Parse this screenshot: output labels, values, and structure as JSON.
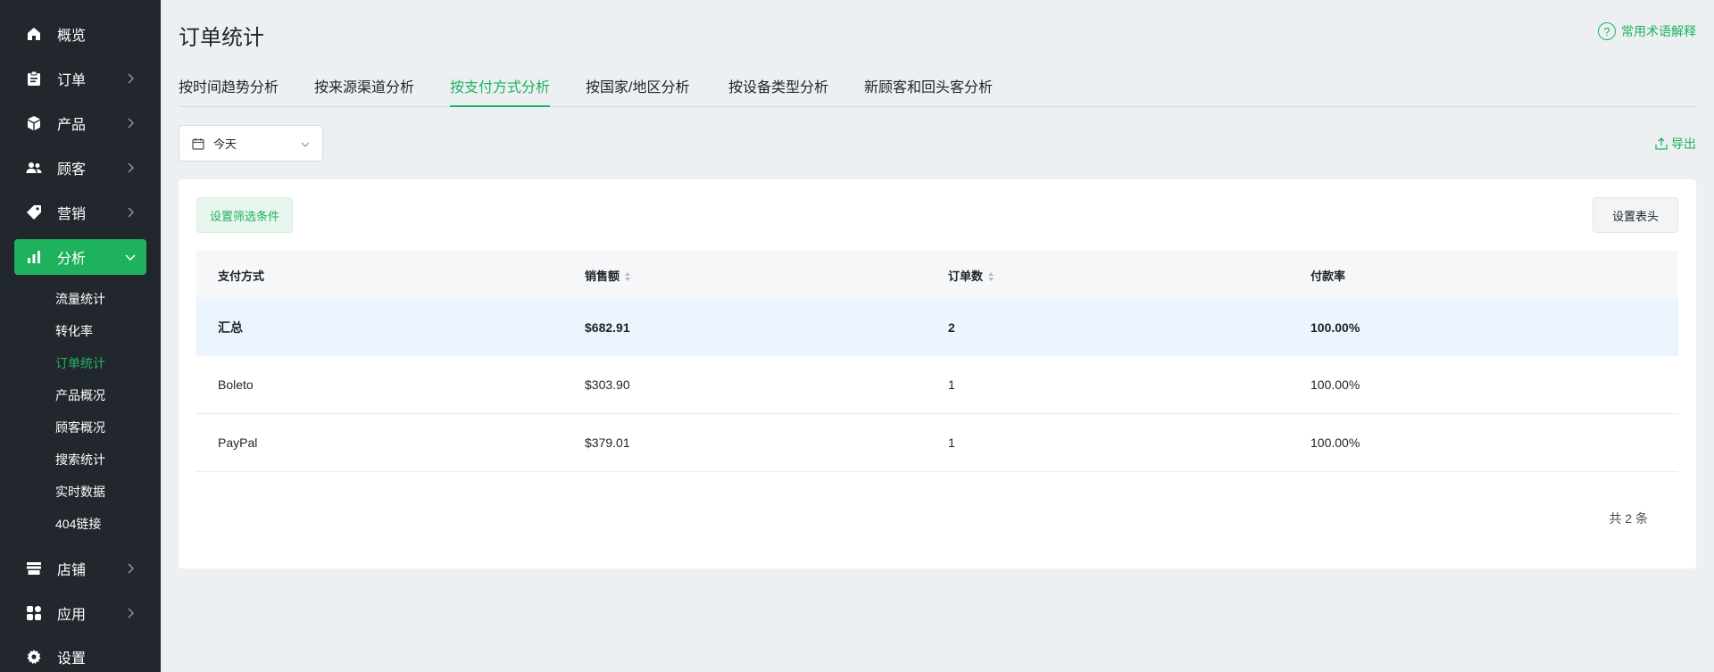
{
  "sidebar": {
    "items": [
      {
        "label": "概览",
        "icon": "home-icon"
      },
      {
        "label": "订单",
        "icon": "clipboard-icon"
      },
      {
        "label": "产品",
        "icon": "box-icon"
      },
      {
        "label": "顾客",
        "icon": "users-icon"
      },
      {
        "label": "营销",
        "icon": "tag-icon"
      },
      {
        "label": "分析",
        "icon": "bar-chart-icon"
      },
      {
        "label": "店铺",
        "icon": "store-icon"
      },
      {
        "label": "应用",
        "icon": "apps-icon"
      },
      {
        "label": "设置",
        "icon": "gear-icon"
      }
    ],
    "sub_items": [
      "流量统计",
      "转化率",
      "订单统计",
      "产品概况",
      "顾客概况",
      "搜索统计",
      "实时数据",
      "404链接"
    ],
    "active_sub": "订单统计"
  },
  "header": {
    "title": "订单统计",
    "help_label": "常用术语解释"
  },
  "tabs": [
    "按时间趋势分析",
    "按来源渠道分析",
    "按支付方式分析",
    "按国家/地区分析",
    "按设备类型分析",
    "新顾客和回头客分析"
  ],
  "active_tab": "按支付方式分析",
  "date_picker": {
    "value": "今天"
  },
  "export_label": "导出",
  "card": {
    "filter_label": "设置筛选条件",
    "columns_label": "设置表头"
  },
  "table": {
    "headers": [
      "支付方式",
      "销售额",
      "订单数",
      "付款率"
    ],
    "total": {
      "method": "汇总",
      "sales": "$682.91",
      "orders": "2",
      "rate": "100.00%"
    },
    "rows": [
      {
        "method": "Boleto",
        "sales": "$303.90",
        "orders": "1",
        "rate": "100.00%"
      },
      {
        "method": "PayPal",
        "sales": "$379.01",
        "orders": "1",
        "rate": "100.00%"
      }
    ]
  },
  "pager": {
    "total_text": "共 2 条"
  },
  "colors": {
    "accent": "#1fb25e",
    "sidebar_bg": "#22272e",
    "total_row_bg": "#ecf4fe"
  }
}
